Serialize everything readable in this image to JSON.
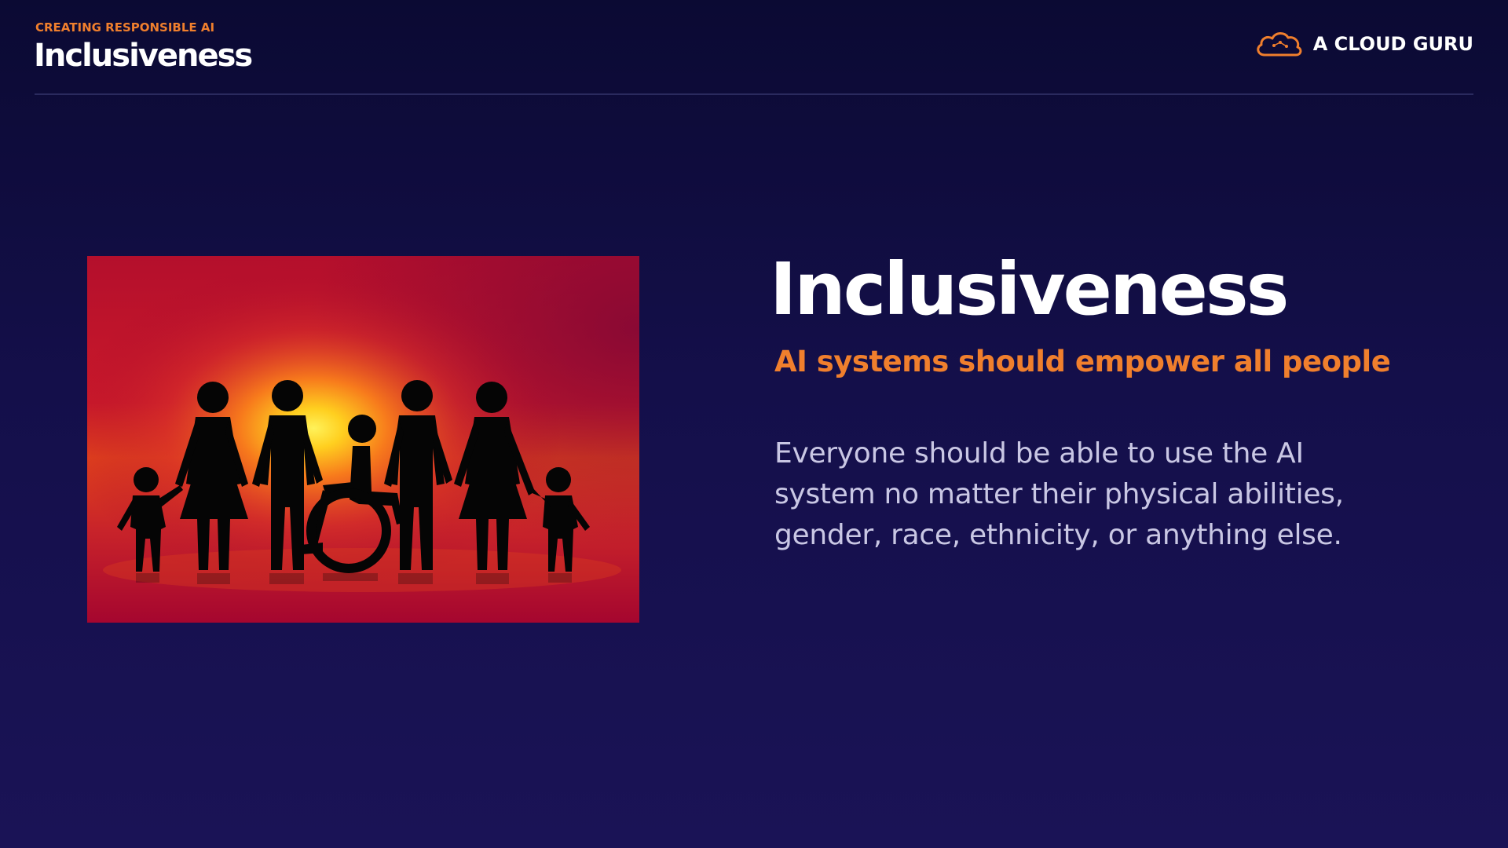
{
  "header": {
    "eyebrow": "CREATING RESPONSIBLE AI",
    "title": "Inclusiveness"
  },
  "brand": {
    "name": "A CLOUD GURU",
    "icon": "cloud-icon",
    "accent_color": "#f07f2d"
  },
  "image": {
    "icon": "inclusive-family-silhouette-image",
    "description_colors": [
      "#a5032d",
      "#e2431a",
      "#ffd21e"
    ]
  },
  "main": {
    "title": "Inclusiveness",
    "subtitle": "AI systems should empower all people",
    "body": "Everyone should be able to use the AI system no matter their physical abilities, gender, race, ethnicity, or anything else."
  },
  "colors": {
    "background": "#120e44",
    "accent": "#f07f2d",
    "title": "#ffffff",
    "body": "#c9c7e4"
  }
}
